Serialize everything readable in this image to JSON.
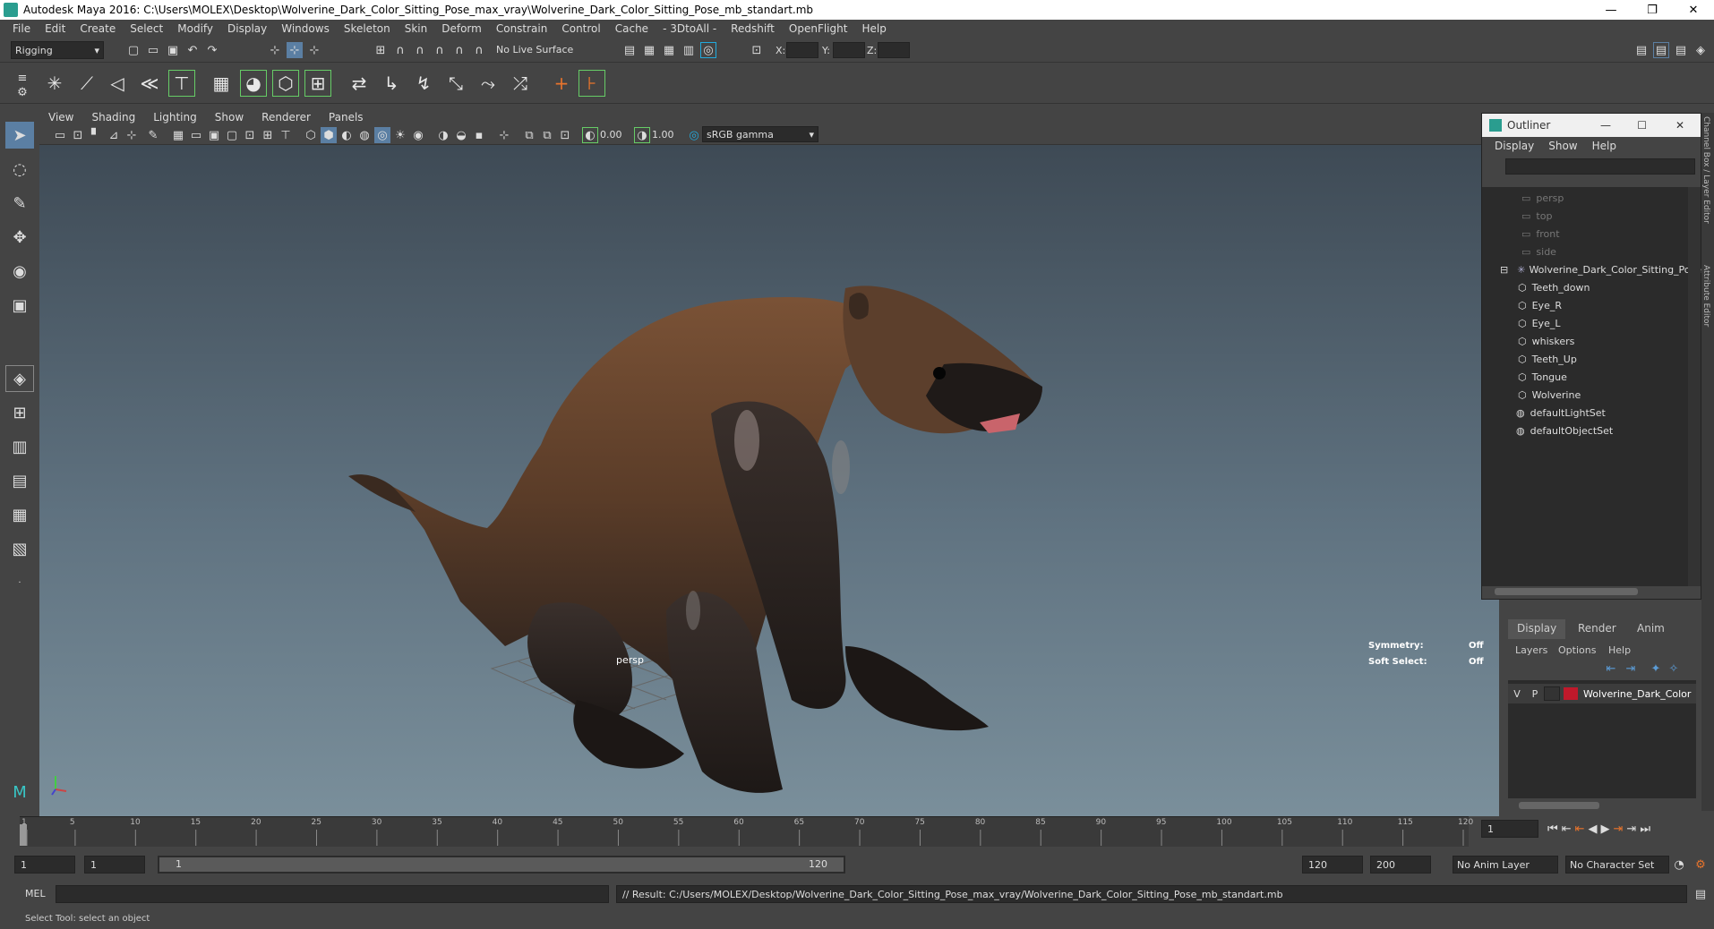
{
  "window": {
    "title": "Autodesk Maya 2016: C:\\Users\\MOLEX\\Desktop\\Wolverine_Dark_Color_Sitting_Pose_max_vray\\Wolverine_Dark_Color_Sitting_Pose_mb_standart.mb",
    "minimize": "—",
    "restore": "❐",
    "close": "✕"
  },
  "menubar": [
    "File",
    "Edit",
    "Create",
    "Select",
    "Modify",
    "Display",
    "Windows",
    "Skeleton",
    "Skin",
    "Deform",
    "Constrain",
    "Control",
    "Cache",
    "- 3DtoAll -",
    "Redshift",
    "OpenFlight",
    "Help"
  ],
  "statusline": {
    "menuset": "Rigging",
    "live_surface": "No Live Surface",
    "x_label": "X:",
    "y_label": "Y:",
    "z_label": "Z:"
  },
  "viewport": {
    "menu": [
      "View",
      "Shading",
      "Lighting",
      "Show",
      "Renderer",
      "Panels"
    ],
    "exposure": "0.00",
    "gamma": "1.00",
    "color_space": "sRGB gamma",
    "camera_label": "persp",
    "symmetry_label": "Symmetry:",
    "symmetry_value": "Off",
    "soft_select_label": "Soft Select:",
    "soft_select_value": "Off"
  },
  "outliner": {
    "title": "Outliner",
    "menu": [
      "Display",
      "Show",
      "Help"
    ],
    "items": [
      {
        "label": "persp",
        "dim": true
      },
      {
        "label": "top",
        "dim": true
      },
      {
        "label": "front",
        "dim": true
      },
      {
        "label": "side",
        "dim": true
      },
      {
        "label": "Wolverine_Dark_Color_Sitting_Pose",
        "dim": false
      },
      {
        "label": "Teeth_down",
        "dim": false
      },
      {
        "label": "Eye_R",
        "dim": false
      },
      {
        "label": "Eye_L",
        "dim": false
      },
      {
        "label": "whiskers",
        "dim": false
      },
      {
        "label": "Teeth_Up",
        "dim": false
      },
      {
        "label": "Tongue",
        "dim": false
      },
      {
        "label": "Wolverine",
        "dim": false
      },
      {
        "label": "defaultLightSet",
        "dim": false
      },
      {
        "label": "defaultObjectSet",
        "dim": false
      }
    ]
  },
  "side_tabs": {
    "channel_box": "Channel Box / Layer Editor",
    "attribute_editor": "Attribute Editor"
  },
  "layer_editor": {
    "tabs": [
      "Display",
      "Render",
      "Anim"
    ],
    "menu": [
      "Layers",
      "Options",
      "Help"
    ],
    "layer": {
      "v": "V",
      "p": "P",
      "name": "Wolverine_Dark_Color",
      "color": "#c0192b"
    }
  },
  "timeline": {
    "ticks": [
      "1",
      "5",
      "10",
      "15",
      "20",
      "25",
      "30",
      "35",
      "40",
      "45",
      "50",
      "55",
      "60",
      "65",
      "70",
      "75",
      "80",
      "85",
      "90",
      "95",
      "100",
      "105",
      "110",
      "115",
      "120"
    ],
    "current_frame": "1"
  },
  "range": {
    "start": "1",
    "playback_start": "1",
    "slider_start": "1",
    "slider_end": "120",
    "playback_end": "120",
    "end": "200",
    "anim_layer": "No Anim Layer",
    "character_set": "No Character Set"
  },
  "command": {
    "mode": "MEL",
    "result": "// Result: C:/Users/MOLEX/Desktop/Wolverine_Dark_Color_Sitting_Pose_max_vray/Wolverine_Dark_Color_Sitting_Pose_mb_standart.mb"
  },
  "help_line": "Select Tool: select an object"
}
